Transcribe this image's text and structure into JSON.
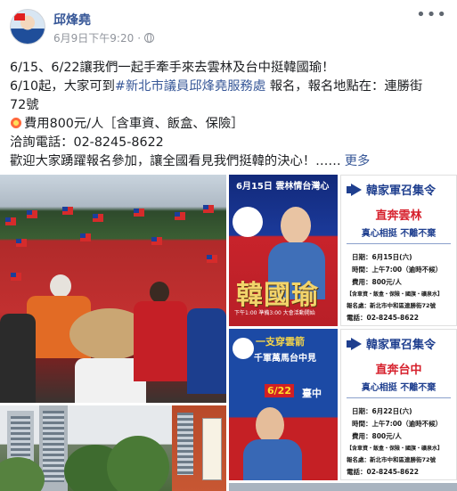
{
  "post": {
    "author": "邱烽堯",
    "timestamp": "6月9日下午9:20",
    "dot": "·",
    "more_label": "•••",
    "lines": {
      "l1": "6/15、6/22讓我們一起手牽手來去雲林及台中挺韓國瑜！",
      "l2a": "6/10起，大家可到",
      "l2_link": "#新北市議員邱烽堯服務處",
      "l2b": "報名，報名地點在：連勝街",
      "l3": "72號",
      "l4": "費用800元/人［含車資、飯盒、保險］",
      "l5": "洽詢電話：02-8245-8622",
      "l6": "歡迎大家踴躍報名參加，讓全國看見我們挺韓的決心！……",
      "see_more": "更多"
    }
  },
  "poster1": {
    "title": "6月15日 雲林情台灣心",
    "name": "韓國瑜",
    "footer": "下午1:00 準備3:00 大會活動開始"
  },
  "card1": {
    "title": "韓家軍召集令",
    "destination": "直奔雲林",
    "slogan": "真心相挺 不離不棄",
    "date": "日期：6月15日(六)",
    "time": "時間：上午7:00（逾時不候）",
    "fee": "費用：800元/人",
    "includes": "【含車資・飯盒・保險・國旗・礦泉水】",
    "place": "報名處：新北市中和區連勝街72號",
    "phone": "電話：02-8245-8622"
  },
  "poster2": {
    "top": "一支穿雲箭",
    "mid": "千軍萬馬台中見",
    "date": "6/22",
    "city": "臺中"
  },
  "card2": {
    "title": "韓家軍召集令",
    "destination": "直奔台中",
    "slogan": "真心相挺 不離不棄",
    "date": "日期：6月22日(六)",
    "time": "時間：上午7:00（逾時不候）",
    "fee": "費用：800元/人",
    "includes": "【含車資・飯盒・保險・國旗・礦泉水】",
    "place": "報名處：新北市中和區連勝街72號",
    "phone": "電話：02-8245-8622"
  },
  "colors": {
    "link": "#385898",
    "flag_red": "#d62b2b",
    "flag_blue": "#1d3e9a"
  }
}
